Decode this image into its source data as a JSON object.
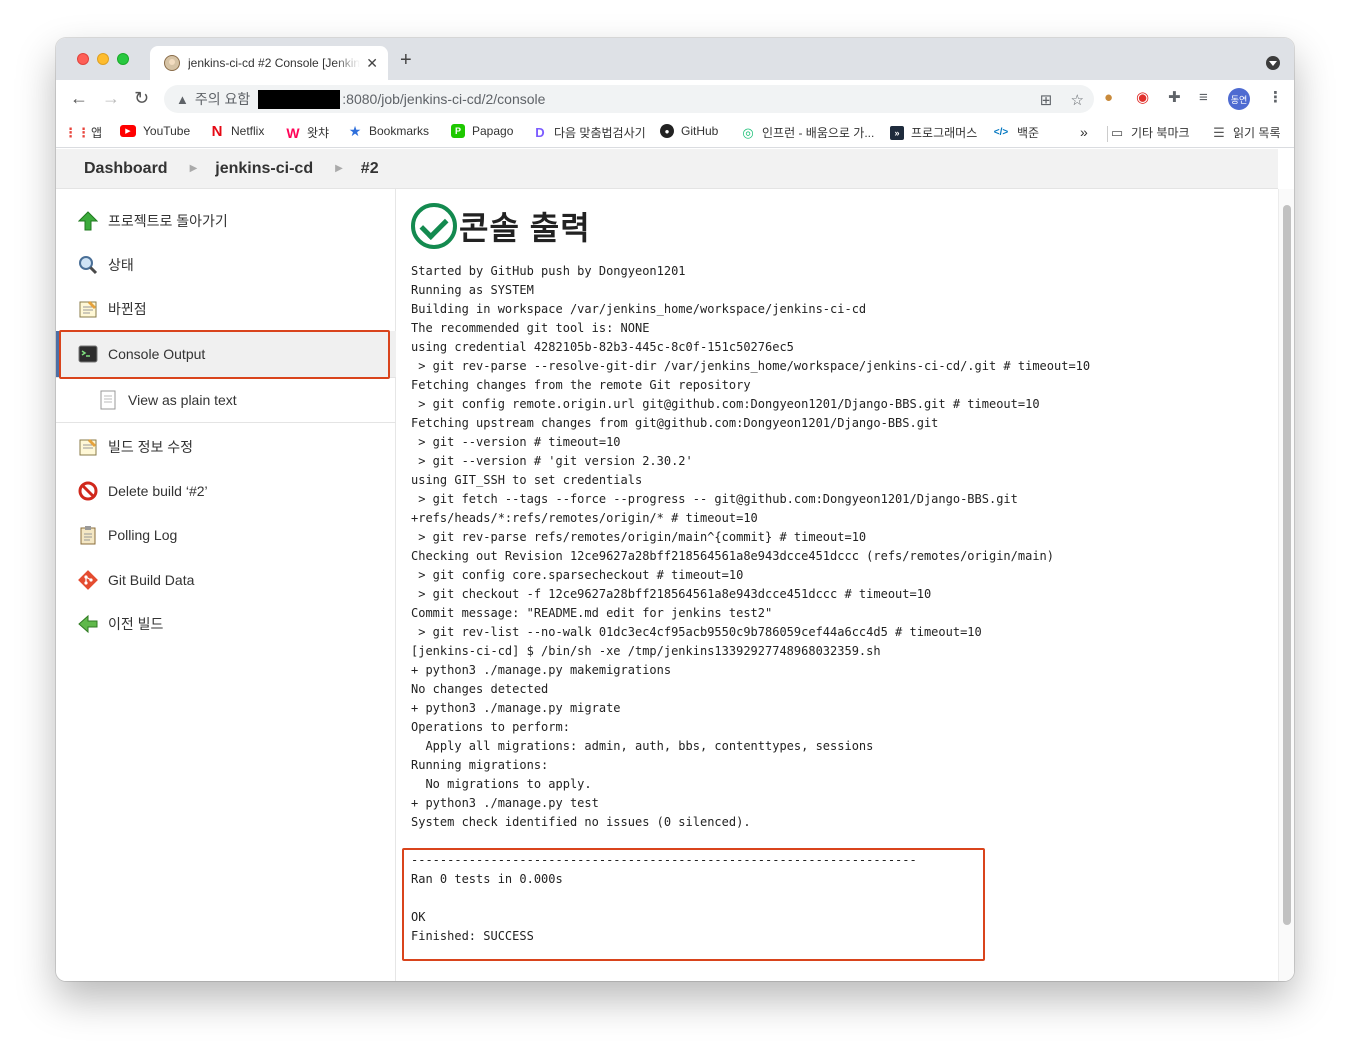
{
  "browser": {
    "tab_title": "jenkins-ci-cd #2 Console [Jenkins]",
    "tab_close": "✕",
    "new_tab": "+",
    "security_warning": "주의 요함",
    "url_suffix": ":8080/job/jenkins-ci-cd/2/console",
    "profile_label": "동연",
    "bookmarks": [
      {
        "label": "앱",
        "icon": "apps-grid-icon"
      },
      {
        "label": "YouTube",
        "icon": "youtube-icon"
      },
      {
        "label": "Netflix",
        "icon": "netflix-icon"
      },
      {
        "label": "왓챠",
        "icon": "watcha-icon"
      },
      {
        "label": "Bookmarks",
        "icon": "star-icon"
      },
      {
        "label": "Papago",
        "icon": "papago-icon"
      },
      {
        "label": "다음 맞춤법검사기",
        "icon": "daum-icon"
      },
      {
        "label": "GitHub",
        "icon": "github-icon"
      },
      {
        "label": "인프런 - 배움으로 가...",
        "icon": "inflearn-icon"
      },
      {
        "label": "프로그래머스",
        "icon": "programmers-icon"
      },
      {
        "label": "백준",
        "icon": "baekjoon-icon"
      }
    ],
    "more_bookmarks": "»",
    "other_bookmarks": "기타 북마크",
    "reading_list": "읽기 목록"
  },
  "breadcrumb": {
    "items": [
      "Dashboard",
      "jenkins-ci-cd",
      "#2"
    ]
  },
  "sidebar": {
    "items": [
      {
        "label": "프로젝트로 돌아가기",
        "icon": "up-arrow-icon"
      },
      {
        "label": "상태",
        "icon": "magnifier-icon"
      },
      {
        "label": "바뀐점",
        "icon": "notepad-icon"
      },
      {
        "label": "Console Output",
        "icon": "terminal-icon"
      },
      {
        "label": "View as plain text",
        "icon": "document-icon"
      },
      {
        "label": "빌드 정보 수정",
        "icon": "notepad-edit-icon"
      },
      {
        "label": "Delete build ‘#2’",
        "icon": "no-entry-icon"
      },
      {
        "label": "Polling Log",
        "icon": "clipboard-icon"
      },
      {
        "label": "Git Build Data",
        "icon": "git-icon"
      },
      {
        "label": "이전 빌드",
        "icon": "back-arrow-icon"
      }
    ]
  },
  "main": {
    "title": "콘솔 출력",
    "console_lines": [
      "Started by GitHub push by Dongyeon1201",
      "Running as SYSTEM",
      "Building in workspace /var/jenkins_home/workspace/jenkins-ci-cd",
      "The recommended git tool is: NONE",
      "using credential 4282105b-82b3-445c-8c0f-151c50276ec5",
      " > git rev-parse --resolve-git-dir /var/jenkins_home/workspace/jenkins-ci-cd/.git # timeout=10",
      "Fetching changes from the remote Git repository",
      " > git config remote.origin.url git@github.com:Dongyeon1201/Django-BBS.git # timeout=10",
      "Fetching upstream changes from git@github.com:Dongyeon1201/Django-BBS.git",
      " > git --version # timeout=10",
      " > git --version # 'git version 2.30.2'",
      "using GIT_SSH to set credentials",
      " > git fetch --tags --force --progress -- git@github.com:Dongyeon1201/Django-BBS.git",
      "+refs/heads/*:refs/remotes/origin/* # timeout=10",
      " > git rev-parse refs/remotes/origin/main^{commit} # timeout=10",
      "Checking out Revision 12ce9627a28bff218564561a8e943dcce451dccc (refs/remotes/origin/main)",
      " > git config core.sparsecheckout # timeout=10",
      " > git checkout -f 12ce9627a28bff218564561a8e943dcce451dccc # timeout=10",
      "Commit message: \"README.md edit for jenkins test2\"",
      " > git rev-list --no-walk 01dc3ec4cf95acb9550c9b786059cef44a6cc4d5 # timeout=10",
      "[jenkins-ci-cd] $ /bin/sh -xe /tmp/jenkins13392927748968032359.sh",
      "+ python3 ./manage.py makemigrations",
      "No changes detected",
      "+ python3 ./manage.py migrate",
      "Operations to perform:",
      "  Apply all migrations: admin, auth, bbs, contenttypes, sessions",
      "Running migrations:",
      "  No migrations to apply.",
      "+ python3 ./manage.py test",
      "System check identified no issues (0 silenced).",
      "",
      "----------------------------------------------------------------------",
      "Ran 0 tests in 0.000s",
      "",
      "OK",
      "Finished: SUCCESS"
    ]
  },
  "colors": {
    "highlight_box": "#d9441c",
    "success_green": "#138a4f",
    "active_sidebar_bar": "#4d6fa5"
  }
}
